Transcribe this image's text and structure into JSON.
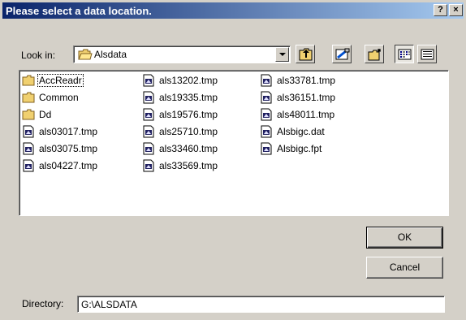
{
  "window": {
    "title": "Please select a data location.",
    "help_label": "?",
    "close_label": "×"
  },
  "lookin": {
    "label": "Look in:",
    "value": "Alsdata"
  },
  "toolbar": [
    "up-one-level-icon",
    "desktop-icon",
    "new-folder-icon",
    "list-view-icon",
    "details-view-icon"
  ],
  "columns": [
    [
      {
        "name": "AccReadr",
        "type": "folder"
      },
      {
        "name": "Common",
        "type": "folder"
      },
      {
        "name": "Dd",
        "type": "folder"
      },
      {
        "name": "als03017.tmp",
        "type": "file"
      },
      {
        "name": "als03075.tmp",
        "type": "file"
      },
      {
        "name": "als04227.tmp",
        "type": "file"
      }
    ],
    [
      {
        "name": "als13202.tmp",
        "type": "file"
      },
      {
        "name": "als19335.tmp",
        "type": "file"
      },
      {
        "name": "als19576.tmp",
        "type": "file"
      },
      {
        "name": "als25710.tmp",
        "type": "file"
      },
      {
        "name": "als33460.tmp",
        "type": "file"
      },
      {
        "name": "als33569.tmp",
        "type": "file"
      }
    ],
    [
      {
        "name": "als33781.tmp",
        "type": "file"
      },
      {
        "name": "als36151.tmp",
        "type": "file"
      },
      {
        "name": "als48011.tmp",
        "type": "file"
      },
      {
        "name": "Alsbigc.dat",
        "type": "file"
      },
      {
        "name": "Alsbigc.fpt",
        "type": "file"
      }
    ]
  ],
  "buttons": {
    "ok": "OK",
    "cancel": "Cancel"
  },
  "directory": {
    "label": "Directory:",
    "value": "G:\\ALSDATA"
  },
  "colors": {
    "titlebar_start": "#0a246a",
    "titlebar_end": "#a6caf0",
    "face": "#d4d0c8",
    "folder": "#f0d070"
  }
}
